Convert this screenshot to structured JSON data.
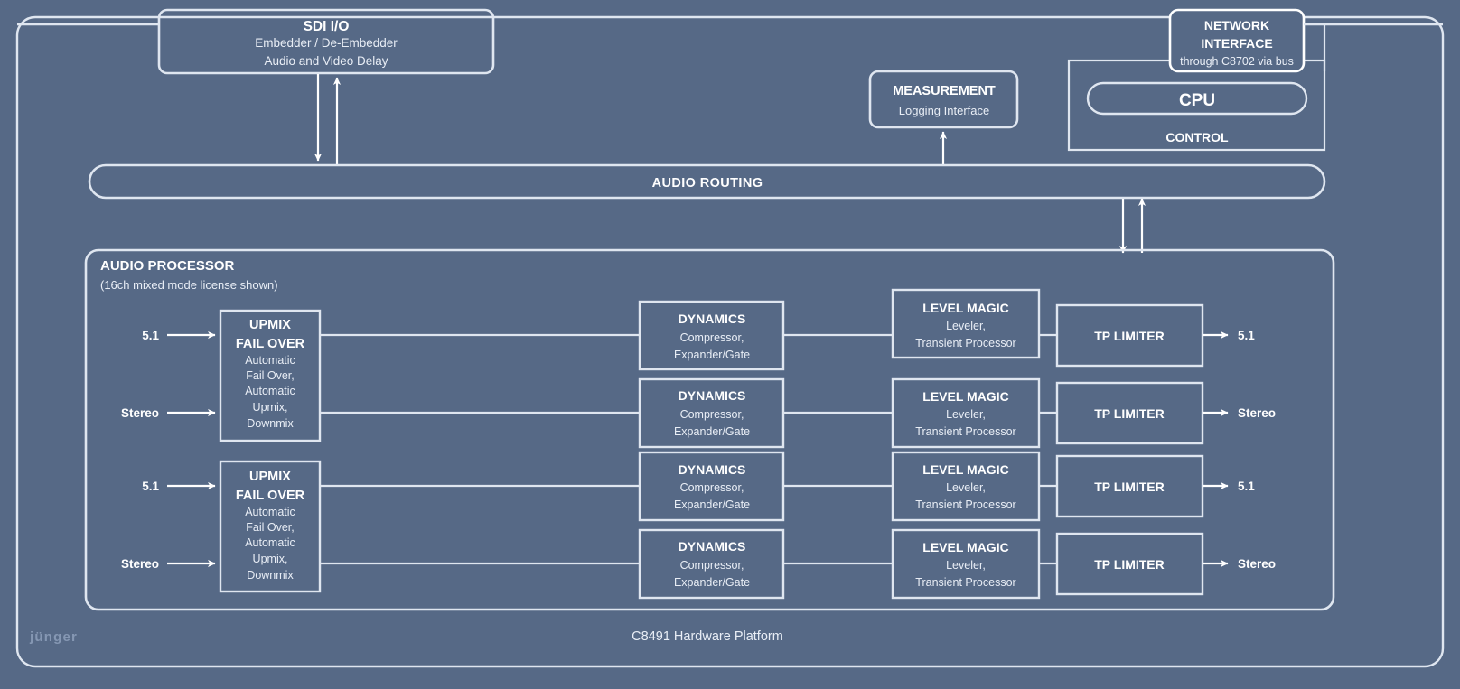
{
  "page": {
    "background_color": "#566986",
    "line_color": "#dfe6f0",
    "text_color": "#ffffff",
    "caption": "C8491 Hardware Platform",
    "logo": "jünger"
  },
  "blocks": {
    "sdi": {
      "title": "SDI I/O",
      "line2": "Embedder / De-Embedder",
      "line3": "Audio and Video Delay"
    },
    "measurement": {
      "title": "MEASUREMENT",
      "line2": "Logging Interface"
    },
    "network": {
      "title_line1": "NETWORK",
      "title_line2": "INTERFACE",
      "subtitle": "through C8702 via bus"
    },
    "control": {
      "cpu": "CPU",
      "label": "CONTROL"
    },
    "audio_routing": {
      "label": "AUDIO ROUTING"
    },
    "audio_processor": {
      "title": "AUDIO PROCESSOR",
      "subtitle": "(16ch mixed mode license shown)"
    }
  },
  "upmix_blocks": [
    {
      "title_line1": "UPMIX",
      "title_line2": "FAIL OVER",
      "details": [
        "Automatic",
        "Fail Over,",
        "Automatic",
        "Upmix,",
        "Downmix"
      ]
    },
    {
      "title_line1": "UPMIX",
      "title_line2": "FAIL OVER",
      "details": [
        "Automatic",
        "Fail Over,",
        "Automatic",
        "Upmix,",
        "Downmix"
      ]
    }
  ],
  "inputs": [
    {
      "label": "5.1"
    },
    {
      "label": "Stereo"
    },
    {
      "label": "5.1"
    },
    {
      "label": "Stereo"
    }
  ],
  "outputs": [
    {
      "label": "5.1"
    },
    {
      "label": "Stereo"
    },
    {
      "label": "5.1"
    },
    {
      "label": "Stereo"
    }
  ],
  "chains": [
    {
      "dynamics": {
        "title": "DYNAMICS",
        "l2": "Compressor,",
        "l3": "Expander/Gate"
      },
      "level_magic": {
        "title": "LEVEL MAGIC",
        "l2": "Leveler,",
        "l3": "Transient Processor"
      },
      "tp_limiter": {
        "title": "TP LIMITER"
      }
    },
    {
      "dynamics": {
        "title": "DYNAMICS",
        "l2": "Compressor,",
        "l3": "Expander/Gate"
      },
      "level_magic": {
        "title": "LEVEL MAGIC",
        "l2": "Leveler,",
        "l3": "Transient Processor"
      },
      "tp_limiter": {
        "title": "TP LIMITER"
      }
    },
    {
      "dynamics": {
        "title": "DYNAMICS",
        "l2": "Compressor,",
        "l3": "Expander/Gate"
      },
      "level_magic": {
        "title": "LEVEL MAGIC",
        "l2": "Leveler,",
        "l3": "Transient Processor"
      },
      "tp_limiter": {
        "title": "TP LIMITER"
      }
    },
    {
      "dynamics": {
        "title": "DYNAMICS",
        "l2": "Compressor,",
        "l3": "Expander/Gate"
      },
      "level_magic": {
        "title": "LEVEL MAGIC",
        "l2": "Leveler,",
        "l3": "Transient Processor"
      },
      "tp_limiter": {
        "title": "TP LIMITER"
      }
    }
  ]
}
